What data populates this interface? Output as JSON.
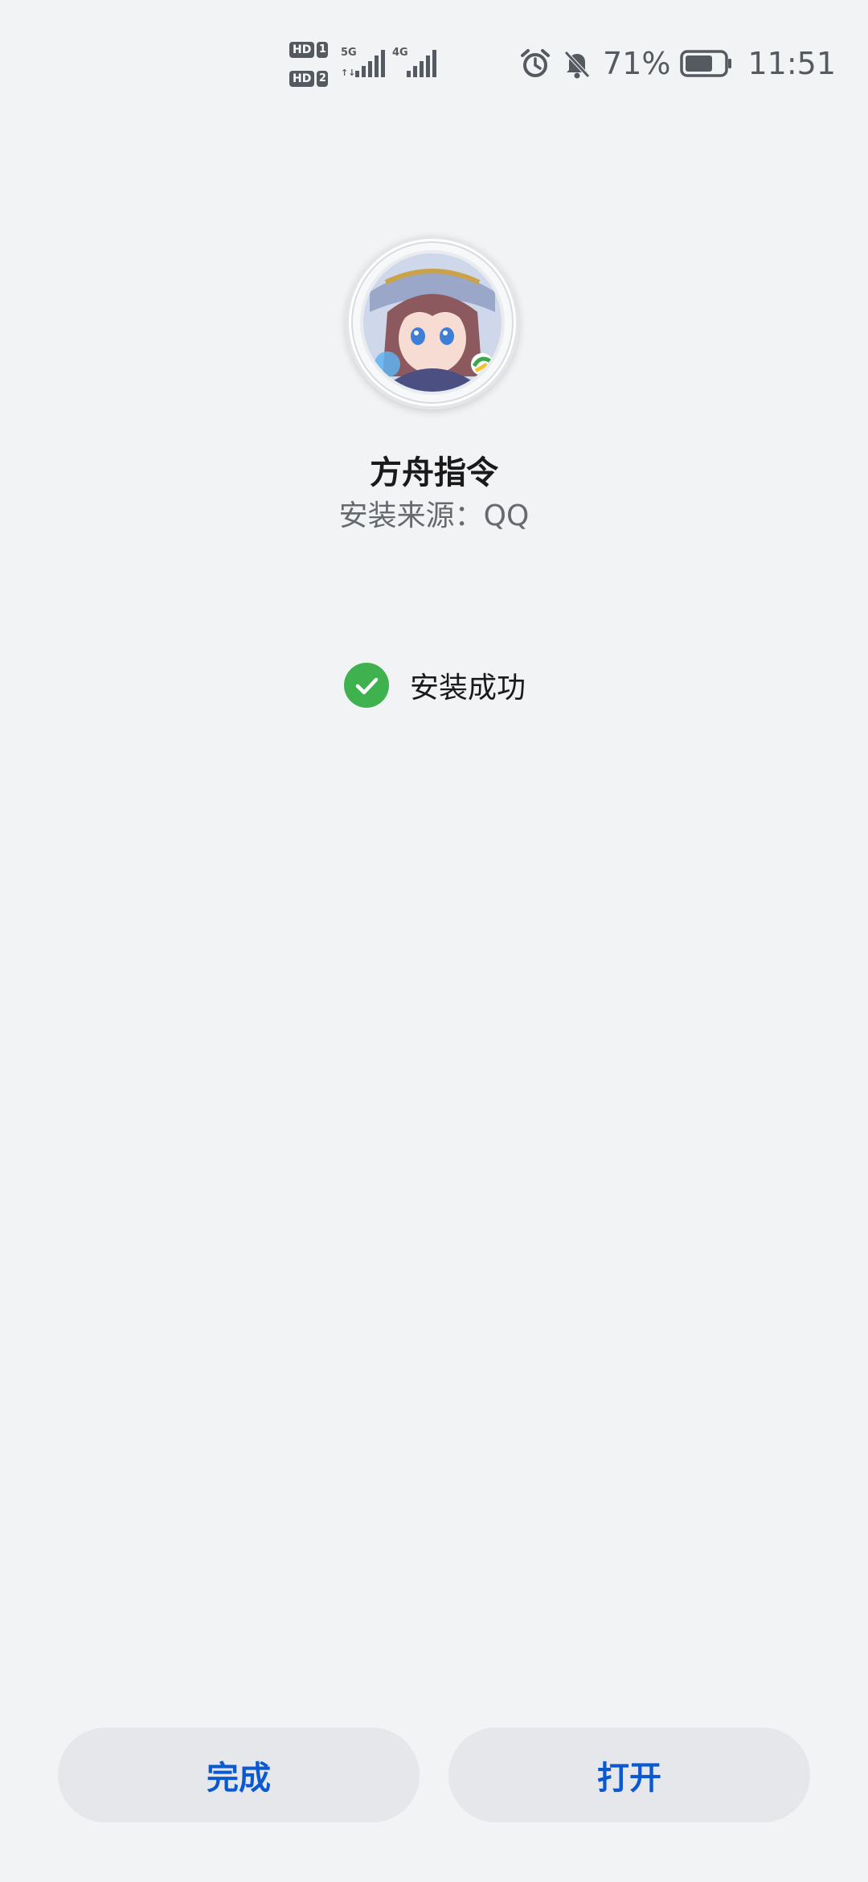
{
  "status_bar": {
    "sim1_label": "HD",
    "sim1_num": "1",
    "sim2_label": "HD",
    "sim2_num": "2",
    "sim1_network": "5G",
    "sim2_network": "4G",
    "battery_percent": "71%",
    "battery_level": 0.71,
    "time": "11:51",
    "icons": [
      "alarm-icon",
      "bell-off-icon",
      "battery-icon"
    ],
    "icon_color": "#555a60"
  },
  "app": {
    "name": "方舟指令",
    "source_label": "安装来源：",
    "source_value": "QQ",
    "icon": "app-avatar-icon"
  },
  "status": {
    "message": "安装成功",
    "icon": "check-circle-icon",
    "color": "#3fb24f"
  },
  "buttons": {
    "done_label": "完成",
    "open_label": "打开",
    "text_color": "#0a59d0",
    "background": "#e5e7ea"
  },
  "page": {
    "background": "#f1f3f5"
  }
}
